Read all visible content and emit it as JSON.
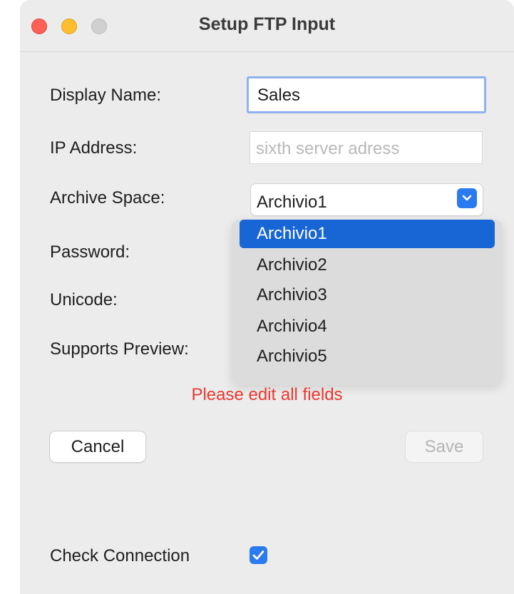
{
  "window": {
    "title": "Setup FTP Input"
  },
  "form": {
    "display_name_label": "Display Name:",
    "display_name_value": "Sales",
    "ip_address_label": "IP Address:",
    "ip_address_placeholder": "sixth server adress",
    "archive_space_label": "Archive Space:",
    "archive_space_value": "Archivio1",
    "password_label": "Password:",
    "unicode_label": "Unicode:",
    "supports_preview_label": "Supports Preview:"
  },
  "dropdown": {
    "options": [
      "Archivio1",
      "Archivio2",
      "Archivio3",
      "Archivio4",
      "Archivio5"
    ],
    "selected": "Archivio1"
  },
  "error_message": "Please edit all fields",
  "buttons": {
    "cancel": "Cancel",
    "save": "Save"
  },
  "check_connection": {
    "label": "Check Connection",
    "checked": true
  },
  "colors": {
    "accent": "#2a7af0",
    "selection": "#1865d6",
    "error": "#e8382f",
    "close": "#fe5f57",
    "minimize": "#febc2e"
  },
  "icons": [
    "chevron-down-icon",
    "checkmark-icon"
  ]
}
